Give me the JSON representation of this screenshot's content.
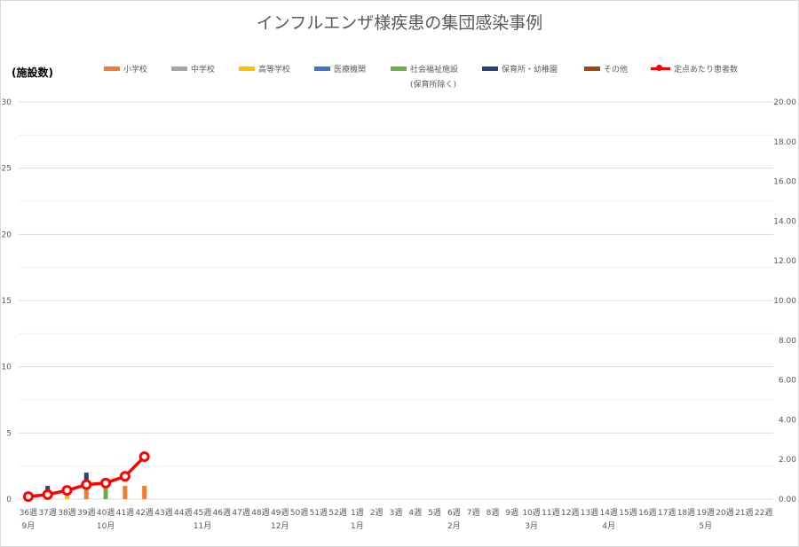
{
  "chart_data": {
    "type": "bar",
    "title": "インフルエンザ様疾患の集団感染事例",
    "ylabel": "(施設数)",
    "ylim": [
      0,
      30
    ],
    "y2lim": [
      0,
      20
    ],
    "yticks": [
      "0",
      "5",
      "10",
      "15",
      "20",
      "25",
      "30"
    ],
    "y2ticks": [
      "0.00",
      "2.00",
      "4.00",
      "6.00",
      "8.00",
      "10.00",
      "12.00",
      "14.00",
      "16.00",
      "18.00",
      "20.00"
    ],
    "categories": [
      "36週",
      "37週",
      "38週",
      "39週",
      "40週",
      "41週",
      "42週",
      "43週",
      "44週",
      "45週",
      "46週",
      "47週",
      "48週",
      "49週",
      "50週",
      "51週",
      "52週",
      "1週",
      "2週",
      "3週",
      "4週",
      "5週",
      "6週",
      "7週",
      "8週",
      "9週",
      "10週",
      "11週",
      "12週",
      "13週",
      "14週",
      "15週",
      "16週",
      "17週",
      "18週",
      "19週",
      "20週",
      "21週",
      "22週"
    ],
    "months": [
      {
        "label": "9月",
        "index": 0
      },
      {
        "label": "10月",
        "index": 4
      },
      {
        "label": "11月",
        "index": 9
      },
      {
        "label": "12月",
        "index": 13
      },
      {
        "label": "1月",
        "index": 17
      },
      {
        "label": "2月",
        "index": 22
      },
      {
        "label": "3月",
        "index": 26
      },
      {
        "label": "4月",
        "index": 30
      },
      {
        "label": "5月",
        "index": 35
      }
    ],
    "series": [
      {
        "name": "小学校",
        "color": "#ed7d31",
        "values": [
          0,
          0,
          0,
          1,
          0,
          1,
          1
        ]
      },
      {
        "name": "中学校",
        "color": "#a5a5a5",
        "values": [
          0,
          0,
          0,
          0,
          0,
          0,
          0
        ]
      },
      {
        "name": "高等学校",
        "color": "#ffc000",
        "values": [
          0,
          0,
          1,
          0,
          0,
          0,
          0
        ]
      },
      {
        "name": "医療機関",
        "color": "#4472c4",
        "values": [
          0,
          0,
          0,
          0,
          0,
          0,
          0
        ]
      },
      {
        "name": "社会福祉施設",
        "color": "#70ad47",
        "values": [
          0,
          0,
          0,
          0,
          1,
          0,
          0
        ]
      },
      {
        "name": "保育所・幼稚園",
        "color": "#264478",
        "values": [
          0,
          1,
          0,
          1,
          0,
          0,
          0
        ]
      },
      {
        "name": "その他",
        "color": "#9e480e",
        "values": [
          0,
          0,
          0,
          0,
          0,
          0,
          0
        ]
      }
    ],
    "line": {
      "name": "定点あたり患者数",
      "color": "#ff0000",
      "values": [
        0.13,
        0.23,
        0.44,
        0.73,
        0.81,
        1.15,
        2.14
      ]
    },
    "legend_note": "(保育所除く)",
    "legend_position": "top",
    "grid": true
  }
}
